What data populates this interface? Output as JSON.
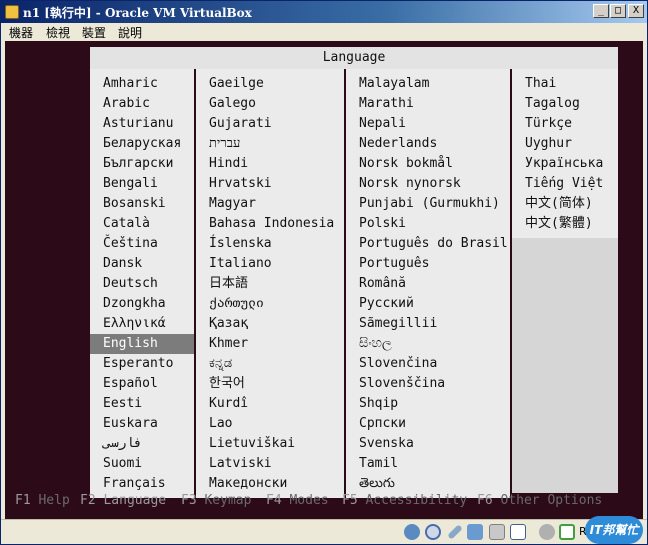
{
  "window": {
    "title": "n1 [執行中] - Oracle VM VirtualBox",
    "minimize_glyph": "_",
    "maximize_glyph": "□",
    "close_glyph": "X"
  },
  "menubar": {
    "items": [
      "機器",
      "檢視",
      "裝置",
      "說明"
    ]
  },
  "language_menu": {
    "title": "Language",
    "selected": "English",
    "columns": [
      [
        "Amharic",
        "Arabic",
        "Asturianu",
        "Беларуская",
        "Български",
        "Bengali",
        "Bosanski",
        "Català",
        "Čeština",
        "Dansk",
        "Deutsch",
        "Dzongkha",
        "Ελληνικά",
        "English",
        "Esperanto",
        "Español",
        "Eesti",
        "Euskara",
        "فارسی",
        "Suomi",
        "Français"
      ],
      [
        "Gaeilge",
        "Galego",
        "Gujarati",
        "עברית",
        "Hindi",
        "Hrvatski",
        "Magyar",
        "Bahasa Indonesia",
        "Íslenska",
        "Italiano",
        "日本語",
        "ქართული",
        "Қазақ",
        "Khmer",
        "ಕನ್ನಡ",
        "한국어",
        "Kurdî",
        "Lao",
        "Lietuviškai",
        "Latviski",
        "Македонски"
      ],
      [
        "Malayalam",
        "Marathi",
        "Nepali",
        "Nederlands",
        "Norsk bokmål",
        "Norsk nynorsk",
        "Punjabi (Gurmukhi)",
        "Polski",
        "Português do Brasil",
        "Português",
        "Română",
        "Русский",
        "Sãmegillii",
        "සිංහල",
        "Slovenčina",
        "Slovenščina",
        "Shqip",
        "Српски",
        "Svenska",
        "Tamil",
        "తెలుగు"
      ],
      [
        "Thai",
        "Tagalog",
        "Türkçe",
        "Uyghur",
        "Українська",
        "Tiếng Việt",
        "中文(简体)",
        "中文(繁體)"
      ]
    ]
  },
  "function_keys": [
    {
      "key": "F1",
      "label": "Help"
    },
    {
      "key": "F2",
      "label": "Language"
    },
    {
      "key": "F3",
      "label": "Keymap"
    },
    {
      "key": "F4",
      "label": "Modes"
    },
    {
      "key": "F5",
      "label": "Accessibility"
    },
    {
      "key": "F6",
      "label": "Other Options"
    }
  ],
  "statusbar": {
    "icons": [
      "hard-disk-icon",
      "optical-drive-icon",
      "pen-icon",
      "network-icon",
      "usb-icon",
      "shared-folder-icon",
      "mouse-integration-icon",
      "capture-arrow-icon"
    ],
    "host_key": "R",
    "badge_text": "IT邦幫忙"
  },
  "colors": {
    "screen_bg": "#2c0a18",
    "panel_bg": "#ebebeb",
    "selected_bg": "#7c7c7c",
    "title_gradient_start": "#0a246a"
  }
}
